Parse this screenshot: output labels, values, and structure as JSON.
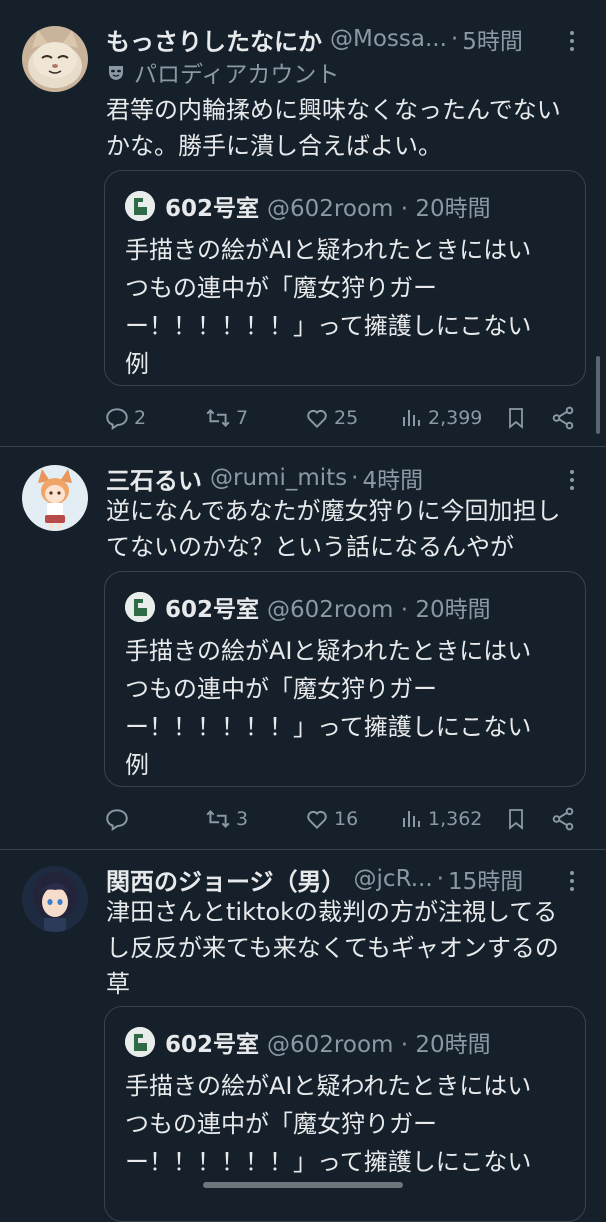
{
  "tweets": [
    {
      "name": "もっさりしたなにか",
      "handle": "@Mossa...",
      "time": "5時間",
      "parody_label": "パロディアカウント",
      "text_lines": [
        "君等の内輪揉めに興味なくなったんでない",
        "かな。勝手に潰し合えばよい。"
      ],
      "quote": {
        "name": "602号室",
        "handle": "@602room · 20時間",
        "text_lines": [
          "手描きの絵がAIと疑われたときにはい",
          "つもの連中が「魔女狩りガー",
          "ー！！！！！！」って擁護しにこない",
          "例"
        ]
      },
      "replies": "2",
      "reposts": "7",
      "likes": "25",
      "views": "2,399"
    },
    {
      "name": "三石るい",
      "handle": "@rumi_mits",
      "time": "4時間",
      "text_lines": [
        "逆になんであなたが魔女狩りに今回加担し",
        "てないのかな？という話になるんやが"
      ],
      "quote": {
        "name": "602号室",
        "handle": "@602room · 20時間",
        "text_lines": [
          "手描きの絵がAIと疑われたときにはい",
          "つもの連中が「魔女狩りガー",
          "ー！！！！！！」って擁護しにこない",
          "例"
        ]
      },
      "replies": "",
      "reposts": "3",
      "likes": "16",
      "views": "1,362"
    },
    {
      "name": "関西のジョージ（男）",
      "handle": "@jcR...",
      "time": "15時間",
      "text_lines": [
        "津田さんとtiktokの裁判の方が注視してる",
        "し反反が来ても来なくてもギャオンするの",
        "草"
      ],
      "quote": {
        "name": "602号室",
        "handle": "@602room · 20時間",
        "text_lines": [
          "手描きの絵がAIと疑われたときにはい",
          "つもの連中が「魔女狩りガー",
          "ー！！！！！！」って擁護しにこない"
        ]
      }
    }
  ],
  "icons": {
    "reply": "reply-icon",
    "repost": "repost-icon",
    "like": "heart-icon",
    "views": "views-icon",
    "bookmark": "bookmark-icon",
    "share": "share-icon",
    "more": "more-icon",
    "parody": "mask-icon"
  },
  "colors": {
    "background": "#15202b",
    "text": "#e7e9ea",
    "muted": "#8b98a5",
    "border": "#38444d"
  }
}
